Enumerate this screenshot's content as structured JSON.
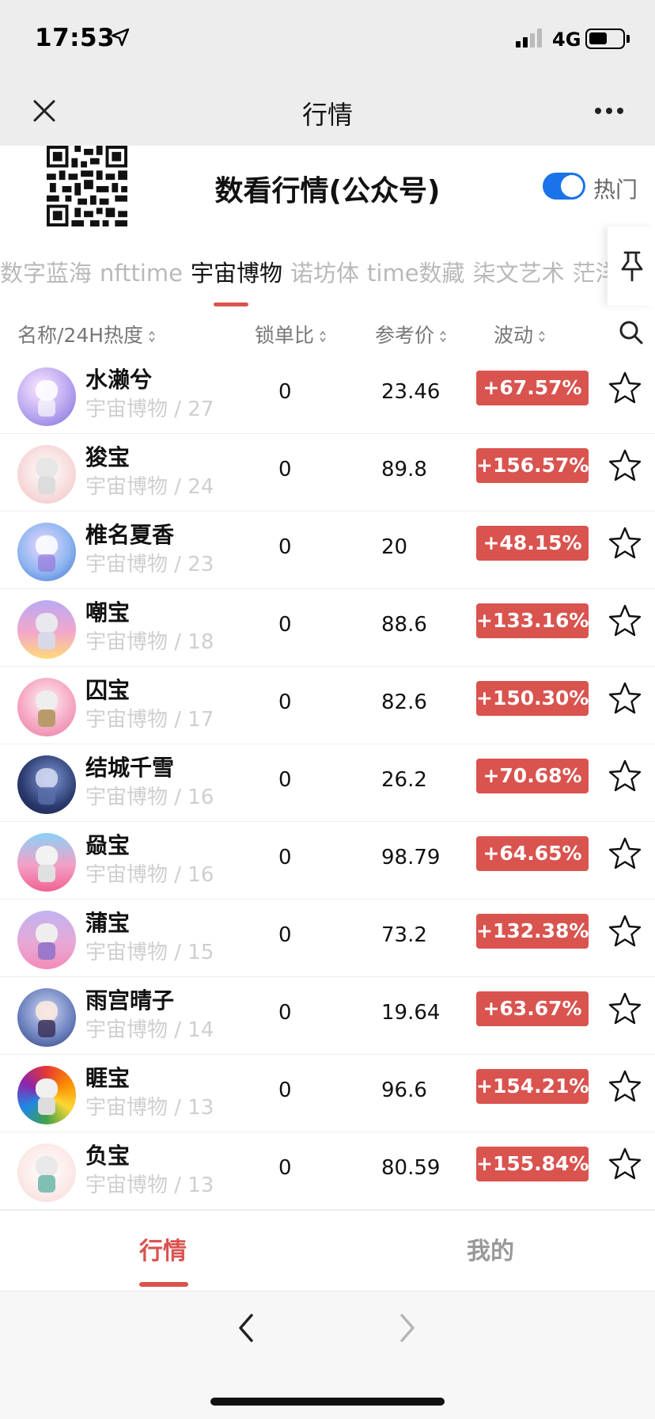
{
  "status_bar": {
    "time": "17:53",
    "network": "4G"
  },
  "nav": {
    "title": "行情"
  },
  "header": {
    "title": "数看行情(公众号)",
    "toggle_label": "热门",
    "toggle_on": true
  },
  "platform_tabs": [
    {
      "label": "数字蓝海",
      "active": false
    },
    {
      "label": "nfttime",
      "active": false
    },
    {
      "label": "宇宙博物",
      "active": true
    },
    {
      "label": "诺坊体",
      "active": false
    },
    {
      "label": "time数藏",
      "active": false
    },
    {
      "label": "柒文艺术",
      "active": false
    },
    {
      "label": "茫洋",
      "active": false
    }
  ],
  "columns": {
    "name": "名称/24H热度",
    "lock_ratio": "锁单比",
    "ref_price": "参考价",
    "change": "波动"
  },
  "rows": [
    {
      "name": "水濑兮",
      "sub": "宇宙博物 / 27",
      "lock": "0",
      "price": "23.46",
      "change": "+67.57%"
    },
    {
      "name": "狻宝",
      "sub": "宇宙博物 / 24",
      "lock": "0",
      "price": "89.8",
      "change": "+156.57%"
    },
    {
      "name": "椎名夏香",
      "sub": "宇宙博物 / 23",
      "lock": "0",
      "price": "20",
      "change": "+48.15%"
    },
    {
      "name": "嘲宝",
      "sub": "宇宙博物 / 18",
      "lock": "0",
      "price": "88.6",
      "change": "+133.16%"
    },
    {
      "name": "囚宝",
      "sub": "宇宙博物 / 17",
      "lock": "0",
      "price": "82.6",
      "change": "+150.30%"
    },
    {
      "name": "结城千雪",
      "sub": "宇宙博物 / 16",
      "lock": "0",
      "price": "26.2",
      "change": "+70.68%"
    },
    {
      "name": "赑宝",
      "sub": "宇宙博物 / 16",
      "lock": "0",
      "price": "98.79",
      "change": "+64.65%"
    },
    {
      "name": "蒲宝",
      "sub": "宇宙博物 / 15",
      "lock": "0",
      "price": "73.2",
      "change": "+132.38%"
    },
    {
      "name": "雨宫晴子",
      "sub": "宇宙博物 / 14",
      "lock": "0",
      "price": "19.64",
      "change": "+63.67%"
    },
    {
      "name": "睚宝",
      "sub": "宇宙博物 / 13",
      "lock": "0",
      "price": "96.6",
      "change": "+154.21%"
    },
    {
      "name": "负宝",
      "sub": "宇宙博物 / 13",
      "lock": "0",
      "price": "80.59",
      "change": "+155.84%"
    }
  ],
  "bottom_tabs": {
    "market": "行情",
    "mine": "我的"
  },
  "colors": {
    "accent": "#d9534f",
    "toggle": "#1a73e8",
    "subtext": "#cfcfcf"
  }
}
